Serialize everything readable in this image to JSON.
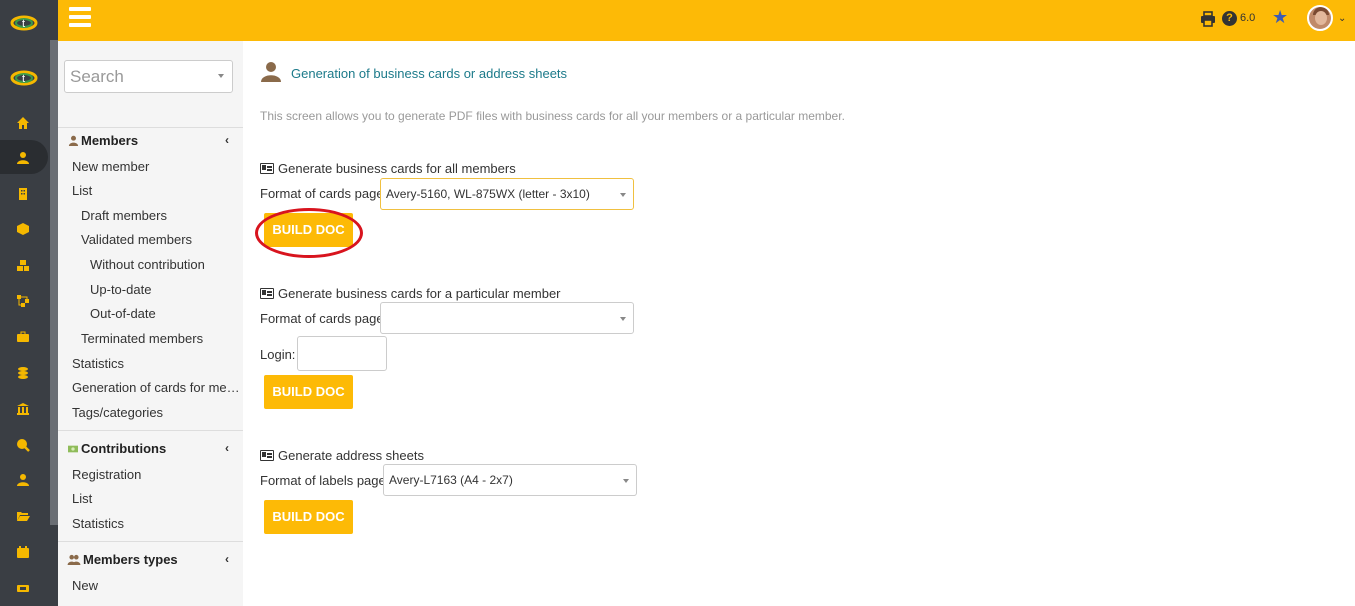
{
  "topbar": {
    "version": "6.0"
  },
  "sidebar": {
    "search_placeholder": "Search",
    "sections": [
      {
        "heading": "Members",
        "icon": "user-icon",
        "items": [
          {
            "label": "New member",
            "level": 0
          },
          {
            "label": "List",
            "level": 0
          },
          {
            "label": "Draft members",
            "level": 1
          },
          {
            "label": "Validated members",
            "level": 1
          },
          {
            "label": "Without contribution",
            "level": 2
          },
          {
            "label": "Up-to-date",
            "level": 2
          },
          {
            "label": "Out-of-date",
            "level": 2
          },
          {
            "label": "Terminated members",
            "level": 1
          },
          {
            "label": "Statistics",
            "level": 0
          },
          {
            "label": "Generation of cards for me…",
            "level": 0
          },
          {
            "label": "Tags/categories",
            "level": 0
          }
        ]
      },
      {
        "heading": "Contributions",
        "icon": "money-icon",
        "items": [
          {
            "label": "Registration",
            "level": 0
          },
          {
            "label": "List",
            "level": 0
          },
          {
            "label": "Statistics",
            "level": 0
          }
        ]
      },
      {
        "heading": "Members types",
        "icon": "users-icon",
        "items": [
          {
            "label": "New",
            "level": 0
          }
        ]
      }
    ]
  },
  "main": {
    "title": "Generation of business cards or address sheets",
    "description": "This screen allows you to generate PDF files with business cards for all your members or a particular member.",
    "section_all": {
      "title": "Generate business cards for all members",
      "format_label": "Format of cards page",
      "format_value": "Avery-5160, WL-875WX (letter - 3x10)",
      "button": "BUILD DOC"
    },
    "section_one": {
      "title": "Generate business cards for a particular member",
      "format_label": "Format of cards page",
      "format_value": "",
      "login_label": "Login:",
      "login_value": "",
      "button": "BUILD DOC"
    },
    "section_address": {
      "title": "Generate address sheets",
      "format_label": "Format of labels page",
      "format_value": "Avery-L7163 (A4 - 2x7)",
      "button": "BUILD DOC"
    }
  },
  "colors": {
    "accent": "#fdba06",
    "rail": "#3a3e44",
    "title_link": "#1c7a8a",
    "highlight_circle": "#d8141e"
  }
}
